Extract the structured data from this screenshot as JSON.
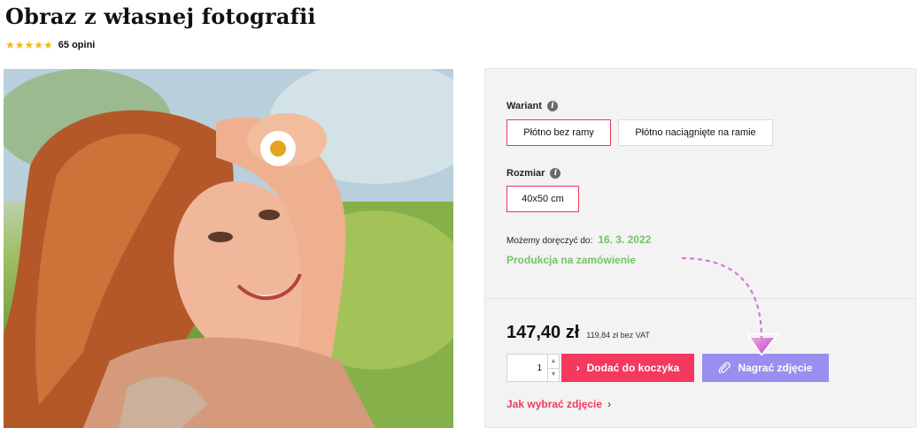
{
  "product": {
    "title": "Obraz z własnej fotografii",
    "stars": "★★★★★",
    "reviews": "65 opini"
  },
  "variant": {
    "label": "Wariant",
    "options": [
      "Płótno bez ramy",
      "Płótno naciągnięte na ramie"
    ],
    "selected": "Płótno bez ramy"
  },
  "size": {
    "label": "Rozmiar",
    "options": [
      "40x50 cm"
    ],
    "selected": "40x50 cm"
  },
  "delivery": {
    "label": "Możemy doręczyć do:",
    "date": "16. 3. 2022",
    "production": "Produkcja na zamówienie"
  },
  "price": {
    "main": "147,40 zł",
    "net": "119,84 zł bez VAT"
  },
  "cart": {
    "quantity": "1",
    "add_label": "Dodać do koczyka",
    "upload_label": "Nagrać zdjęcie"
  },
  "help_link": "Jak wybrać zdjęcie",
  "colors": {
    "accent": "#f4385f",
    "upload": "#9a8ef0",
    "green": "#74c267",
    "star": "#f2b61c"
  }
}
